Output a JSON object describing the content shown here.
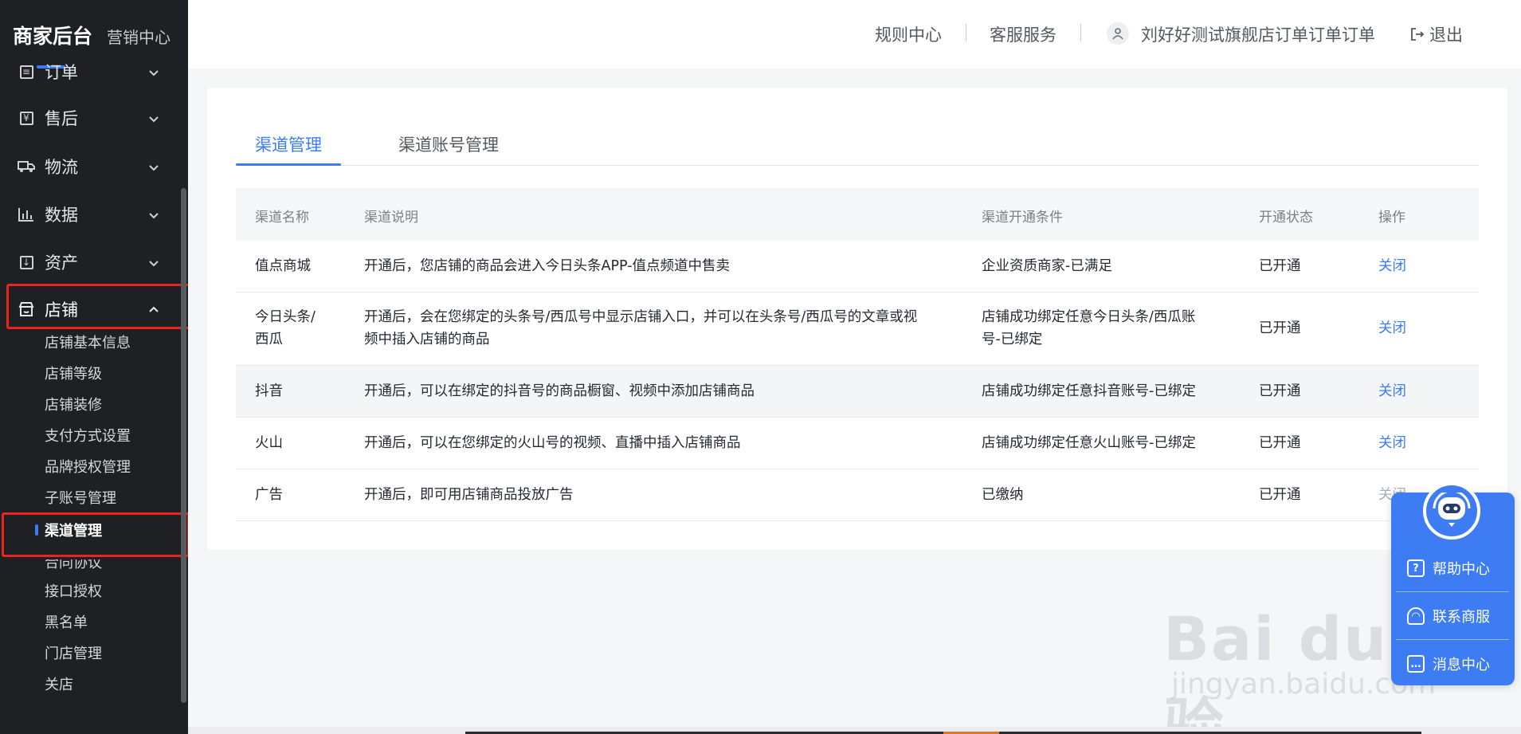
{
  "brand": {
    "main": "商家后台",
    "sub": "营销中心"
  },
  "sidebar": {
    "groups": [
      {
        "label": "订单",
        "icon": "list-icon"
      },
      {
        "label": "售后",
        "icon": "yen-icon"
      },
      {
        "label": "物流",
        "icon": "truck-icon"
      },
      {
        "label": "数据",
        "icon": "bar-chart-icon"
      },
      {
        "label": "资产",
        "icon": "asset-icon"
      },
      {
        "label": "店铺",
        "icon": "store-icon"
      }
    ],
    "shop_items": [
      "店铺基本信息",
      "店铺等级",
      "店铺装修",
      "支付方式设置",
      "品牌授权管理",
      "子账号管理",
      "渠道管理",
      "合同协议",
      "接口授权",
      "黑名单",
      "门店管理",
      "关店"
    ]
  },
  "header": {
    "rules": "规则中心",
    "service": "客服服务",
    "user": "刘好好测试旗舰店订单订单订单",
    "logout": "退出"
  },
  "tabs": [
    "渠道管理",
    "渠道账号管理"
  ],
  "table": {
    "columns": [
      "渠道名称",
      "渠道说明",
      "渠道开通条件",
      "开通状态",
      "操作"
    ],
    "rows": [
      {
        "name": "值点商城",
        "desc": "开通后，您店铺的商品会进入今日头条APP-值点频道中售卖",
        "cond": "企业资质商家-已满足",
        "status": "已开通",
        "action": "关闭"
      },
      {
        "name_l1": "今日头条/",
        "name_l2": "西瓜",
        "desc_l1": "开通后，会在您绑定的头条号/西瓜号中显示店铺入口，并可以在头条号/西瓜号的文章或视",
        "desc_l2": "频中插入店铺的商品",
        "cond_l1": "店铺成功绑定任意今日头条/西瓜账",
        "cond_l2": "号-已绑定",
        "status": "已开通",
        "action": "关闭"
      },
      {
        "name": "抖音",
        "desc": "开通后，可以在绑定的抖音号的商品橱窗、视频中添加店铺商品",
        "cond": "店铺成功绑定任意抖音账号-已绑定",
        "status": "已开通",
        "action": "关闭"
      },
      {
        "name": "火山",
        "desc": "开通后，可以在您绑定的火山号的视频、直播中插入店铺商品",
        "cond": "店铺成功绑定任意火山账号-已绑定",
        "status": "已开通",
        "action": "关闭"
      },
      {
        "name": "广告",
        "desc": "开通后，即可用店铺商品投放广告",
        "cond": "已缴纳",
        "status": "已开通",
        "action": "关闭"
      }
    ]
  },
  "help": {
    "items": [
      "帮助中心",
      "联系商服",
      "消息中心"
    ]
  },
  "watermark": {
    "main": "Bai du 经验",
    "sub": "jingyan.baidu.com"
  },
  "colors": {
    "accent": "#3b7bf6",
    "sidebar_bg": "#1f2023",
    "highlight_box": "#e8251f"
  }
}
